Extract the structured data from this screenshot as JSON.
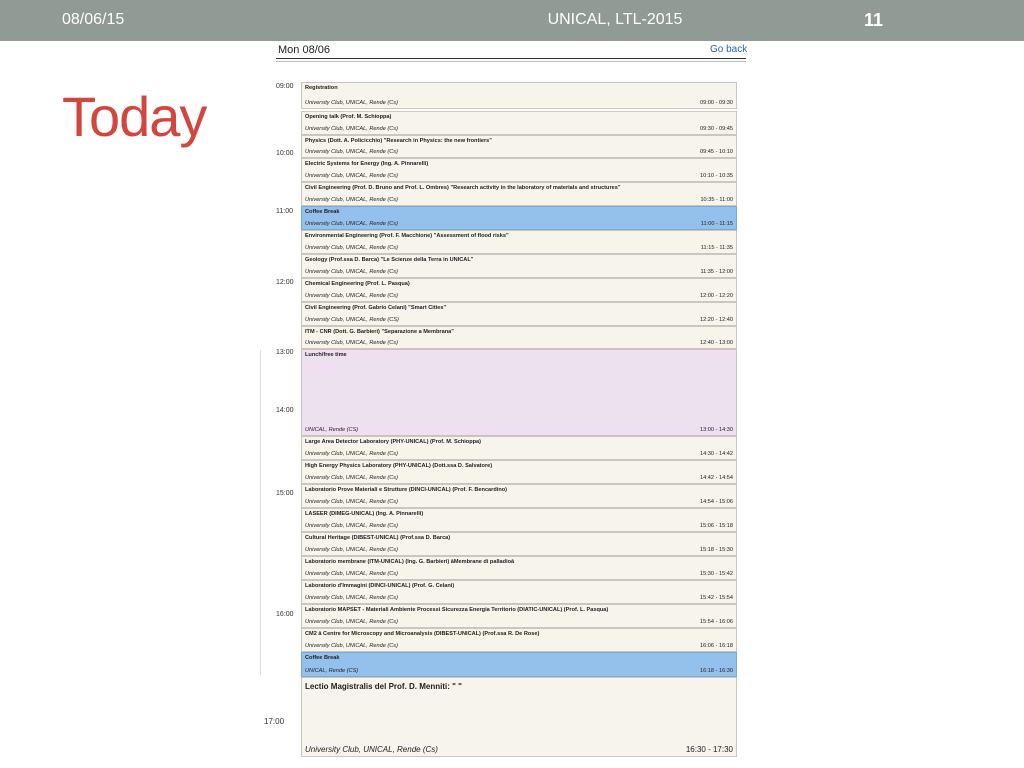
{
  "header": {
    "date": "08/06/15",
    "title": "UNICAL, LTL-2015",
    "slide_number": "11"
  },
  "slide_heading": "Today",
  "calendar": {
    "day_label": "Mon 08/06",
    "back_link": "Go back",
    "hours": [
      "09:00",
      "10:00",
      "11:00",
      "12:00",
      "13:00",
      "14:00",
      "15:00",
      "16:00",
      "17:00"
    ],
    "events": [
      {
        "title": "Registration",
        "location": "University Club, UNICAL, Rende (Cs)",
        "time": "09:00 - 09:30"
      },
      {
        "title": "Opening talk (Prof. M. Schioppa)",
        "location": "University Club, UNICAL, Rende (Cs)",
        "time": "09:30 - 09:45"
      },
      {
        "title": "Physics (Dott. A. Policicchio) \"Research in Physics: the new frontiers\"",
        "location": "University Club, UNICAL, Rende (Cs)",
        "time": "09:45 - 10:10"
      },
      {
        "title": "Electric Systems for Energy (Ing. A. Pinnarelli)",
        "location": "University Club, UNICAL, Rende (Cs)",
        "time": "10:10 - 10:35"
      },
      {
        "title": "Civil Engineering (Prof. D. Bruno and Prof. L. Ombres) \"Research activity in the laboratory of materials and structures\"",
        "location": "University Club, UNICAL, Rende (Cs)",
        "time": "10:35 - 11:00"
      },
      {
        "title": "Coffee Break",
        "location": "University Club, UNICAL, Rende (Cs)",
        "time": "11:00 - 11:15"
      },
      {
        "title": "Environmental Engineering (Prof. F. Macchione) \"Assessment of flood risks\"",
        "location": "University Club, UNICAL, Rende (Cs)",
        "time": "11:15 - 11:35"
      },
      {
        "title": "Geology (Prof.ssa D. Barca) \"Le Scienze della Terra in UNICAL\"",
        "location": "University Club, UNICAL, Rende (Cs)",
        "time": "11:35 - 12:00"
      },
      {
        "title": "Chemical Engineering (Prof. L. Pasqua)",
        "location": "University Club, UNICAL, Rende (Cs)",
        "time": "12:00 - 12:20"
      },
      {
        "title": "Civil Engineering (Prof. Gabrio Celani) \"Smart Cities\"",
        "location": "University Club, UNICAL, Rende (CS)",
        "time": "12:20 - 12:40"
      },
      {
        "title": "ITM - CNR (Dott. G. Barbieri) \"Separazione a Membrana\"",
        "location": "University Club, UNICAL, Rende (Cs)",
        "time": "12:40 - 13:00"
      },
      {
        "title": "Lunch/free time",
        "location": "UNICAL, Rende (CS)",
        "time": "13:00 - 14:30"
      },
      {
        "title": "Large Area Detector Laboratory (PHY-UNICAL) (Prof. M. Schioppa)",
        "location": "University Club, UNICAL, Rende (Cs)",
        "time": "14:30 - 14:42"
      },
      {
        "title": "High Energy Physics Laboratory (PHY-UNICAL) (Dott.ssa D. Salvatore)",
        "location": "University Club, UNICAL, Rende (Cs)",
        "time": "14:42 - 14:54"
      },
      {
        "title": "Laboratorio Prove Materiali e Strutture (DINCI-UNICAL) (Prof. F. Bencardino)",
        "location": "University Club, UNICAL, Rende (Cs)",
        "time": "14:54 - 15:06"
      },
      {
        "title": "LASEER (DIMEG-UNICAL) (Ing. A. Pinnarelli)",
        "location": "University Club, UNICAL, Rende (Cs)",
        "time": "15:06 - 15:18"
      },
      {
        "title": "Cultural Heritage (DIBEST-UNICAL) (Prof.ssa D. Barca)",
        "location": "University Club, UNICAL, Rende (Cs)",
        "time": "15:18 - 15:30"
      },
      {
        "title": "Laboratorio membrane (ITM-UNICAL) (Ing. G. Barbieri) âMembrane di palladioâ",
        "location": "University Club, UNICAL, Rende (Cs)",
        "time": "15:30 - 15:42"
      },
      {
        "title": "Laboratorio d'Immagini (DINCI-UNICAL) (Prof. G. Celani)",
        "location": "University Club, UNICAL, Rende (Cs)",
        "time": "15:42 - 15:54"
      },
      {
        "title": "Laboratorio MAPSET - Materiali Ambiente Processi Sicurezza Energia Territorio (DIATIC-UNICAL) (Prof. L. Pasqua)",
        "location": "University Club, UNICAL, Rende (Cs)",
        "time": "15:54 - 16:06"
      },
      {
        "title": "CM2 â Centre for Microscopy and Microanalysis (DIBEST-UNICAL) (Prof.ssa R. De Rose)",
        "location": "University Club, UNICAL, Rende (Cs)",
        "time": "16:06 - 16:18"
      },
      {
        "title": "Coffee Break",
        "location": "UNICAL, Rende (CS)",
        "time": "16:18 - 16:30"
      },
      {
        "title": "Lectio Magistralis del Prof. D. Menniti: \" \"",
        "location": "University Club, UNICAL, Rende (Cs)",
        "time": "16:30 - 17:30"
      }
    ]
  },
  "colors": {
    "topbar": "#8f9b94",
    "heading": "#d2473d",
    "event": "#f7f4ec",
    "break": "#94c0ec",
    "lunch": "#ede1ef"
  }
}
